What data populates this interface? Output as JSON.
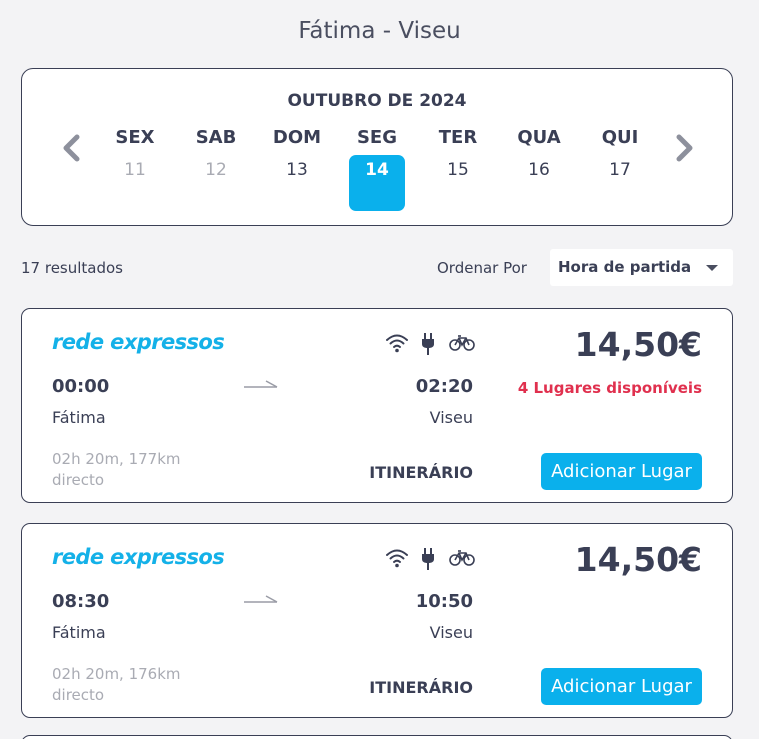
{
  "route_title": "Fátima - Viseu",
  "calendar": {
    "month": "OUTUBRO DE 2024",
    "days": [
      {
        "name": "SEX",
        "num": "11",
        "state": "past"
      },
      {
        "name": "SAB",
        "num": "12",
        "state": "past"
      },
      {
        "name": "DOM",
        "num": "13",
        "state": "normal"
      },
      {
        "name": "SEG",
        "num": "14",
        "state": "selected"
      },
      {
        "name": "TER",
        "num": "15",
        "state": "normal"
      },
      {
        "name": "QUA",
        "num": "16",
        "state": "normal"
      },
      {
        "name": "QUI",
        "num": "17",
        "state": "normal"
      }
    ]
  },
  "results": {
    "count_text": "17 resultados",
    "order_label": "Ordenar Por",
    "order_value": "Hora de partida"
  },
  "trips": [
    {
      "operator": "rede expressos",
      "departure_time": "00:00",
      "arrival_time": "02:20",
      "origin": "Fátima",
      "destination": "Viseu",
      "price": "14,50€",
      "seats": "4 Lugares disponíveis",
      "duration_distance": "02h 20m, 177km",
      "route_type": "directo",
      "itinerary_label": "ITINERÁRIO",
      "add_label": "Adicionar Lugar"
    },
    {
      "operator": "rede expressos",
      "departure_time": "08:30",
      "arrival_time": "10:50",
      "origin": "Fátima",
      "destination": "Viseu",
      "price": "14,50€",
      "seats": "",
      "duration_distance": "02h 20m, 176km",
      "route_type": "directo",
      "itinerary_label": "ITINERÁRIO",
      "add_label": "Adicionar Lugar"
    }
  ],
  "icons": [
    "chevron-left-icon",
    "chevron-right-icon",
    "wifi-icon",
    "power-plug-icon",
    "bicycle-icon",
    "arrow-right-icon",
    "dropdown-caret-icon"
  ],
  "colors": {
    "accent": "#0ab0ec",
    "brand": "#14b1e8",
    "alert": "#e0304e",
    "text": "#3a3f55",
    "muted": "#a9abb3",
    "background": "#f3f3f5"
  }
}
